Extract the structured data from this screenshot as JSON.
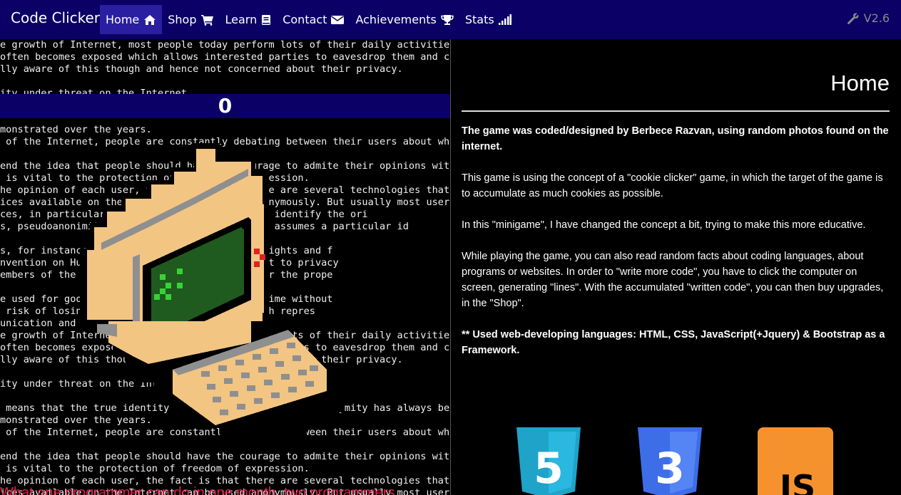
{
  "navbar": {
    "brand": "Code Clicker",
    "items": [
      {
        "label": "Home",
        "icon": "home-icon"
      },
      {
        "label": "Shop",
        "icon": "cart-icon"
      },
      {
        "label": "Learn",
        "icon": "book-icon"
      },
      {
        "label": "Contact",
        "icon": "envelope-icon"
      },
      {
        "label": "Achievements",
        "icon": "trophy-icon"
      },
      {
        "label": "Stats",
        "icon": "signal-icon"
      }
    ],
    "version": "V2.6"
  },
  "game": {
    "counter": "0",
    "code_lines": [
      "e growth of Internet, most people today perform lots of their daily activities",
      "often becomes exposed which allows interested parties to eavesdrop them and col",
      "lly aware of this though and hence not concerned about their privacy.",
      "",
      "ity under threat on the Internet",
      "",
      "",
      "monstrated over the years.",
      " of the Internet, people are constantly debating between their users about whet",
      "",
      "end the idea that people should have the courage to admite their opinions witho",
      " is vital to the protection of freedom of expression.",
      "he opinion of each user, the fact is that there are several technologies that e",
      "ices available on the Internet can be used anonymously. But usually most users",
      "ces, in particular, which allow other users to identify the ori",
      "s, pseudoanonimity, which means that each user assumes a particular id",
      "",
      "s, for instance, protected by constitutional rights and f",
      "nvention on Human Rights guaranteeing the right to privacy",
      "embers of the EU, with exceptions necessary for the prope",
      "",
      "e used for good purposes, include: report a crime without",
      " risk of losing their job, or in countries with repres",
      "unication and",
      "e growth of Internet, most people today perform lots of their daily activities",
      "often becomes exposed which allows interested parties to eavesdrop them and col",
      "lly aware of this though and hence not concerned about their privacy.",
      "",
      "ity under threat on the Internet",
      "",
      " means that the true identity of a person is unknown. Anonymity has always been",
      "monstrated over the years.",
      " of the Internet, people are constantly debating between their users about whet",
      "",
      "end the idea that people should have the courage to admite their opinions witho",
      " is vital to the protection of freedom of expression.",
      "he opinion of each user, the fact is that there are several technologies that e",
      "ices available on the Internet can be used anonymously. But usually most users"
    ],
    "overlay_text": "What one programmer can do in one month, two programmers"
  },
  "home": {
    "title": "Home",
    "paragraphs": [
      "The game was coded/designed by Berbece Razvan, using random photos found on the internet.",
      "This game is using the concept of a \"cookie clicker\" game, in which the target of the game is to accumulate as much cookies as possible.",
      "In this \"minigame\", I have changed the concept a bit, trying to make this more educative.",
      "While playing the game, you can also read random facts about coding languages, about programs or websites. In order to \"write more code\", you have to click the computer on screen, generating \"lines\". With the accumulated \"written code\", you can then buy upgrades, in the \"Shop\".",
      "** Used web-developing languages: HTML, CSS, JavaScript(+Jquery) & Bootstrap as a Framework."
    ],
    "logos": [
      {
        "name": "html5-logo",
        "text": "5",
        "color": "#1fa3c9"
      },
      {
        "name": "css3-logo",
        "text": "3",
        "color": "#3d6ee8"
      },
      {
        "name": "js-logo",
        "text": "JS",
        "color": "#f5922d"
      }
    ]
  }
}
